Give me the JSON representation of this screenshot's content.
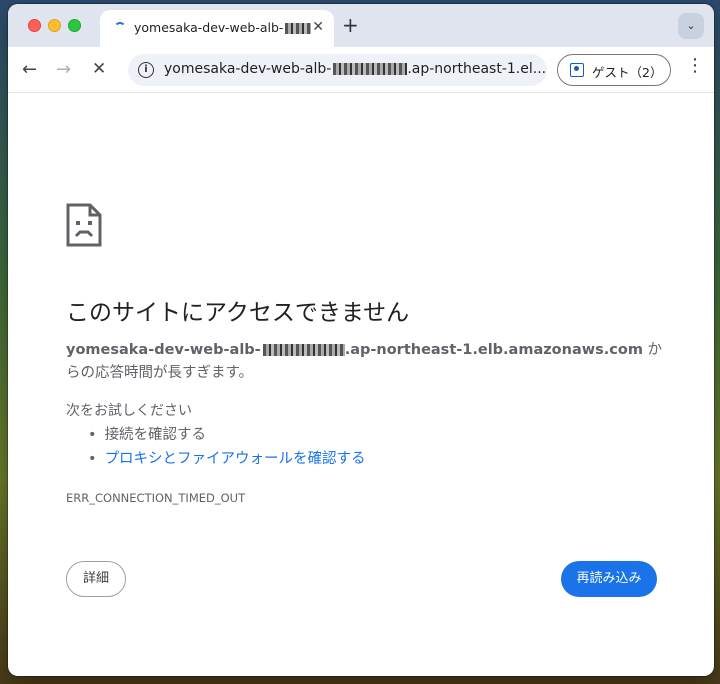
{
  "window": {
    "traffic_lights": [
      "close",
      "minimize",
      "maximize"
    ]
  },
  "tab": {
    "title": "yomesaka-dev-web-alb-",
    "close_glyph": "✕",
    "new_tab_glyph": "+",
    "search_glyph": "⌄"
  },
  "toolbar": {
    "back_glyph": "←",
    "forward_glyph": "→",
    "stop_glyph": "✕",
    "url_prefix": "yomesaka-dev-web-alb-",
    "url_suffix": ".ap-northeast-1.el...",
    "info_glyph": "i",
    "guest_label": "ゲスト（2）",
    "menu_glyph": "⋮"
  },
  "error": {
    "title": "このサイトにアクセスできません",
    "host_prefix": "yomesaka-dev-web-alb-",
    "host_suffix": ".ap-northeast-1.elb.amazonaws.com",
    "desc_tail": " からの応答時間が長すぎます。",
    "suggest_heading": "次をお試しください",
    "suggestions": [
      "接続を確認する",
      "プロキシとファイアウォールを確認する"
    ],
    "code": "ERR_CONNECTION_TIMED_OUT",
    "details_label": "詳細",
    "reload_label": "再読み込み"
  },
  "colors": {
    "accent": "#1a73e8",
    "tabstrip": "#dfe4ef"
  }
}
